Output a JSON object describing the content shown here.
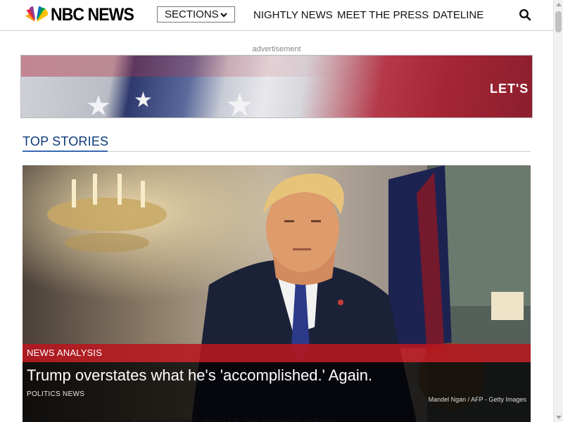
{
  "header": {
    "logo_text": "NBC NEWS",
    "sections_label": "SECTIONS",
    "nav": [
      "NIGHTLY NEWS",
      "MEET THE PRESS",
      "DATELINE"
    ]
  },
  "ad": {
    "label": "advertisement",
    "banner_text": "LET'S S"
  },
  "top_stories": {
    "heading": "TOP STORIES",
    "hero": {
      "kicker": "NEWS ANALYSIS",
      "title": "Trump overstates what he's 'accomplished.' Again.",
      "category": "POLITICS NEWS",
      "photo_credit": "Mandel Ngan / AFP - Getty Images",
      "next_headline": "Trump declares 'mission accomplished' after U.S.-led airstrikes in Syria"
    }
  },
  "colors": {
    "brand_blue": "#0a3a78",
    "kicker_red": "#b8161e",
    "peacock": [
      "#f6a21e",
      "#e3273b",
      "#8e3d96",
      "#0a70b9",
      "#00a14b",
      "#fcc30b"
    ]
  },
  "icons": {
    "search": "search-icon",
    "sections_toggle": "chevron-down-icon",
    "logo": "peacock-icon"
  }
}
